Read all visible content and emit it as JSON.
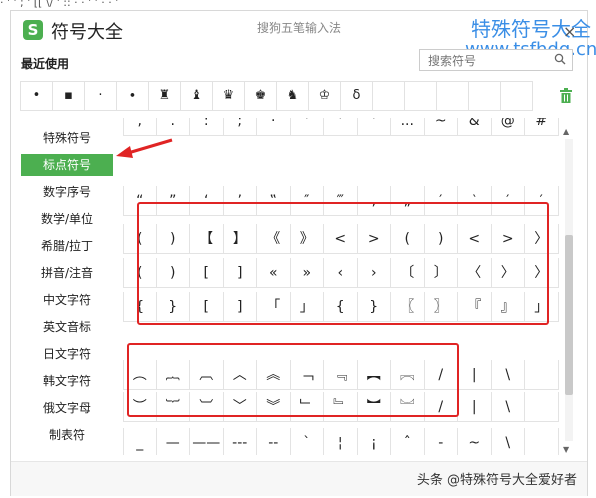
{
  "top_strip": "· ' ' ; ' [[ \\/ ' :: · · ' ' · · '",
  "window": {
    "title": "符号大全",
    "subtitle": "搜狗五笔输入法",
    "close_glyph": "×"
  },
  "watermark": {
    "line1": "特殊符号大全",
    "line2": "www.tsfhdq.cn"
  },
  "recent": {
    "label": "最近使用",
    "items": [
      "•",
      "▪",
      "·",
      "∙",
      "♜",
      "♝",
      "♛",
      "♚",
      "♞",
      "♔",
      "δ",
      "",
      "",
      "",
      "",
      ""
    ]
  },
  "search": {
    "placeholder": "搜索符号"
  },
  "sidebar": {
    "items": [
      "特殊符号",
      "标点符号",
      "数字序号",
      "数学/单位",
      "希腊/拉丁",
      "拼音/注音",
      "中文字符",
      "英文音标",
      "日文字符",
      "韩文字符",
      "俄文字母",
      "制表符"
    ],
    "active_index": 1
  },
  "grid": {
    "rows": [
      [
        ",",
        ".",
        ":",
        ";",
        "·",
        "'",
        "'",
        "'",
        "...",
        "~",
        "&",
        "@",
        "#"
      ],
      [
        "“",
        "”",
        "‘",
        "’",
        "‟",
        "″",
        "‴",
        "‚",
        "„",
        "′",
        "‵",
        "′",
        "′"
      ],
      [
        "(",
        ")",
        "【",
        "】",
        "《",
        "》",
        "<",
        ">",
        "(",
        ")",
        "<",
        ">",
        "〉"
      ],
      [
        "(",
        ")",
        "[",
        "]",
        "«",
        "»",
        "‹",
        "›",
        "〔",
        "〕",
        "〈",
        "〉",
        "〉"
      ],
      [
        "{",
        "}",
        "[",
        "]",
        "「",
        "」",
        "{",
        "}",
        "〖",
        "〗",
        "『",
        "』",
        "」"
      ],
      [
        "",
        "",
        "",
        "",
        "",
        "",
        "",
        "",
        "",
        "",
        "",
        "",
        ""
      ],
      [
        "︵",
        "︷",
        "︹",
        "︿",
        "︽",
        "﹁",
        "﹃",
        "︻",
        "︗",
        "/",
        "|",
        "\\",
        ""
      ],
      [
        "︶",
        "︸",
        "︺",
        "﹀",
        "︾",
        "﹂",
        "﹄",
        "︼",
        "︘",
        "/",
        "|",
        "\\",
        ""
      ],
      [
        "_",
        "—",
        "——",
        "---",
        "--",
        "ˋ",
        "¦",
        "¡",
        "ˆ",
        "-",
        "~",
        "\\",
        ""
      ]
    ]
  },
  "footer": {
    "credit": "头条 @特殊符号大全爱好者"
  },
  "colors": {
    "accent": "#4caf50",
    "highlight": "#e02424",
    "watermark": "#3a8ee6"
  }
}
